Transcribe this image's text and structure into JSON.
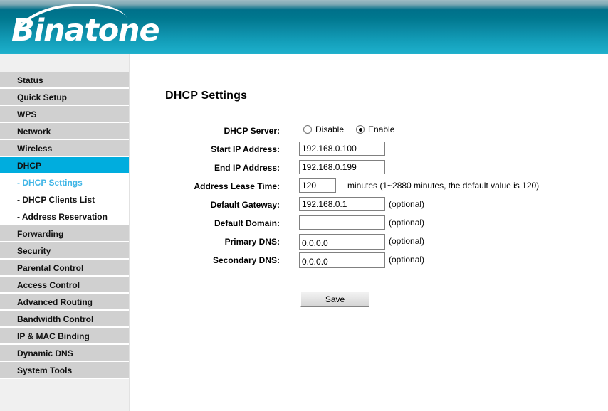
{
  "brand": {
    "name": "Binatone",
    "logo_icon": "swoosh-arc-icon"
  },
  "sidebar": {
    "items": [
      {
        "label": "Status",
        "type": "main",
        "state": "normal"
      },
      {
        "label": "Quick Setup",
        "type": "main",
        "state": "normal"
      },
      {
        "label": "WPS",
        "type": "main",
        "state": "normal"
      },
      {
        "label": "Network",
        "type": "main",
        "state": "normal"
      },
      {
        "label": "Wireless",
        "type": "main",
        "state": "normal"
      },
      {
        "label": "DHCP",
        "type": "main",
        "state": "active"
      },
      {
        "label": "- DHCP Settings",
        "type": "sub",
        "state": "current"
      },
      {
        "label": "- DHCP Clients List",
        "type": "sub",
        "state": "normal"
      },
      {
        "label": "- Address Reservation",
        "type": "sub",
        "state": "normal"
      },
      {
        "label": "Forwarding",
        "type": "main",
        "state": "normal"
      },
      {
        "label": "Security",
        "type": "main",
        "state": "normal"
      },
      {
        "label": "Parental Control",
        "type": "main",
        "state": "normal"
      },
      {
        "label": "Access Control",
        "type": "main",
        "state": "normal"
      },
      {
        "label": "Advanced Routing",
        "type": "main",
        "state": "normal"
      },
      {
        "label": "Bandwidth Control",
        "type": "main",
        "state": "normal"
      },
      {
        "label": "IP & MAC Binding",
        "type": "main",
        "state": "normal"
      },
      {
        "label": "Dynamic DNS",
        "type": "main",
        "state": "normal"
      },
      {
        "label": "System Tools",
        "type": "main",
        "state": "normal"
      }
    ]
  },
  "main": {
    "title": "DHCP Settings",
    "dhcp_server": {
      "label": "DHCP Server:",
      "options": [
        {
          "label": "Disable",
          "checked": false
        },
        {
          "label": "Enable",
          "checked": true
        }
      ]
    },
    "fields": {
      "start_ip": {
        "label": "Start IP Address:",
        "value": "192.168.0.100"
      },
      "end_ip": {
        "label": "End IP Address:",
        "value": "192.168.0.199"
      },
      "lease_time": {
        "label": "Address Lease Time:",
        "value": "120",
        "hint": "minutes (1~2880 minutes, the default value is 120)"
      },
      "default_gateway": {
        "label": "Default Gateway:",
        "value": "192.168.0.1",
        "hint": "(optional)"
      },
      "default_domain": {
        "label": "Default Domain:",
        "value": "",
        "hint": "(optional)"
      },
      "primary_dns": {
        "label": "Primary DNS:",
        "value": "0.0.0.0",
        "hint": "(optional)"
      },
      "secondary_dns": {
        "label": "Secondary DNS:",
        "value": "0.0.0.0",
        "hint": "(optional)"
      }
    },
    "save_label": "Save"
  },
  "colors": {
    "header_dark_teal": "#00708a",
    "header_light_cyan": "#23b2cd",
    "nav_gray": "#d0d0d0",
    "nav_active": "#00adde",
    "nav_current_text": "#3fb5e6"
  }
}
